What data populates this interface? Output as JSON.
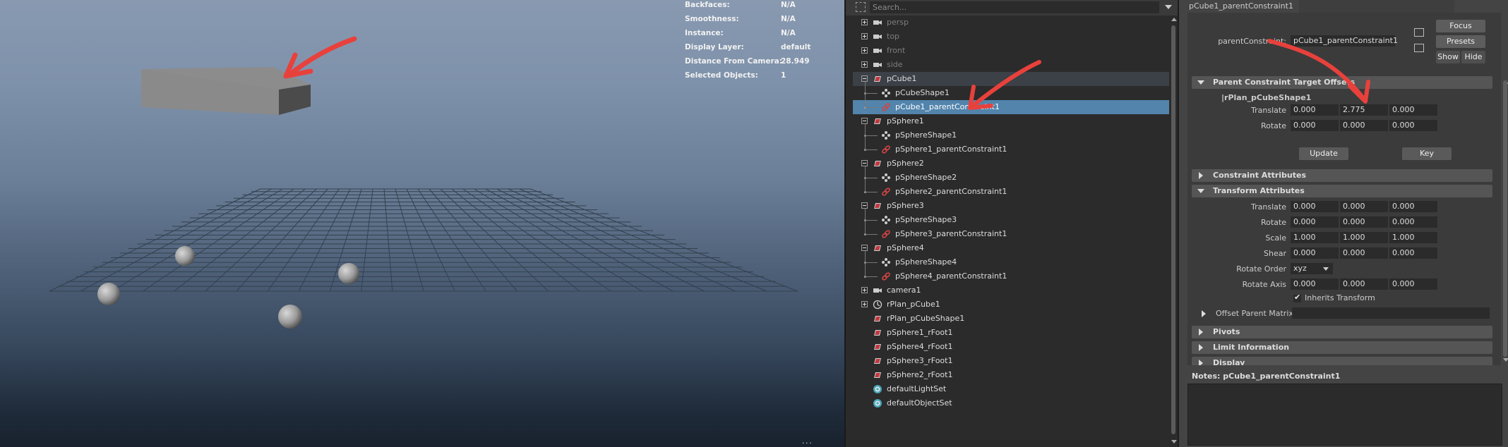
{
  "viewport": {
    "hud": [
      {
        "label": "Backfaces:",
        "value": "N/A"
      },
      {
        "label": "Smoothness:",
        "value": "N/A"
      },
      {
        "label": "Instance:",
        "value": "N/A"
      },
      {
        "label": "Display Layer:",
        "value": "default"
      },
      {
        "label": "Distance From Camera:",
        "value": "28.949"
      },
      {
        "label": "Selected Objects:",
        "value": "1"
      }
    ],
    "bottom_glyph": "···",
    "annotation_color": "#e8413c"
  },
  "outliner": {
    "search_placeholder": "Search...",
    "items": [
      {
        "label": "persp",
        "icon": "camera-icon",
        "expander": "plus",
        "dim": true
      },
      {
        "label": "top",
        "icon": "camera-icon",
        "expander": "plus",
        "dim": true
      },
      {
        "label": "front",
        "icon": "camera-icon",
        "expander": "plus",
        "dim": true
      },
      {
        "label": "side",
        "icon": "camera-icon",
        "expander": "plus",
        "dim": true
      },
      {
        "label": "pCube1",
        "icon": "mesh-transform-icon",
        "expander": "minus",
        "highlight": true
      },
      {
        "label": "pCubeShape1",
        "icon": "shape-icon",
        "child": true
      },
      {
        "label": "pCube1_parentConstraint1",
        "icon": "constraint-icon",
        "child": true,
        "selected": true
      },
      {
        "label": "pSphere1",
        "icon": "mesh-transform-icon",
        "expander": "minus"
      },
      {
        "label": "pSphereShape1",
        "icon": "shape-icon",
        "child": true
      },
      {
        "label": "pSphere1_parentConstraint1",
        "icon": "constraint-icon",
        "child": true
      },
      {
        "label": "pSphere2",
        "icon": "mesh-transform-icon",
        "expander": "minus"
      },
      {
        "label": "pSphereShape2",
        "icon": "shape-icon",
        "child": true
      },
      {
        "label": "pSphere2_parentConstraint1",
        "icon": "constraint-icon",
        "child": true
      },
      {
        "label": "pSphere3",
        "icon": "mesh-transform-icon",
        "expander": "minus"
      },
      {
        "label": "pSphereShape3",
        "icon": "shape-icon",
        "child": true
      },
      {
        "label": "pSphere3_parentConstraint1",
        "icon": "constraint-icon",
        "child": true
      },
      {
        "label": "pSphere4",
        "icon": "mesh-transform-icon",
        "expander": "minus"
      },
      {
        "label": "pSphereShape4",
        "icon": "shape-icon",
        "child": true
      },
      {
        "label": "pSphere4_parentConstraint1",
        "icon": "constraint-icon",
        "child": true
      },
      {
        "label": "camera1",
        "icon": "camera-icon",
        "expander": "plus"
      },
      {
        "label": "rPlan_pCube1",
        "icon": "locator-icon",
        "expander": "plus"
      },
      {
        "label": "rPlan_pCubeShape1",
        "icon": "mesh-transform-icon"
      },
      {
        "label": "pSphere1_rFoot1",
        "icon": "mesh-transform-icon"
      },
      {
        "label": "pSphere4_rFoot1",
        "icon": "mesh-transform-icon"
      },
      {
        "label": "pSphere3_rFoot1",
        "icon": "mesh-transform-icon"
      },
      {
        "label": "pSphere2_rFoot1",
        "icon": "mesh-transform-icon"
      },
      {
        "label": "defaultLightSet",
        "icon": "set-icon"
      },
      {
        "label": "defaultObjectSet",
        "icon": "set-icon"
      }
    ]
  },
  "attribute_editor": {
    "tab": "pCube1_parentConstraint1",
    "node_label": "parentConstraint:",
    "node_value": "pCube1_parentConstraint1",
    "buttons": {
      "focus": "Focus",
      "presets": "Presets",
      "show": "Show",
      "hide": "Hide",
      "update": "Update",
      "key": "Key"
    },
    "target_offsets": {
      "title": "Parent Constraint Target Offsets",
      "target": "|rPlan_pCubeShape1",
      "translate_label": "Translate",
      "translate": [
        "0.000",
        "2.775",
        "0.000"
      ],
      "rotate_label": "Rotate",
      "rotate": [
        "0.000",
        "0.000",
        "0.000"
      ]
    },
    "sections": {
      "constraint_attributes": "Constraint Attributes",
      "transform_attributes": "Transform Attributes",
      "pivots": "Pivots",
      "limit_information": "Limit Information",
      "display": "Display"
    },
    "transform": {
      "translate_label": "Translate",
      "translate": [
        "0.000",
        "0.000",
        "0.000"
      ],
      "rotate_label": "Rotate",
      "rotate": [
        "0.000",
        "0.000",
        "0.000"
      ],
      "scale_label": "Scale",
      "scale": [
        "1.000",
        "1.000",
        "1.000"
      ],
      "shear_label": "Shear",
      "shear": [
        "0.000",
        "0.000",
        "0.000"
      ],
      "rotate_order_label": "Rotate Order",
      "rotate_order": "xyz",
      "rotate_axis_label": "Rotate Axis",
      "rotate_axis": [
        "0.000",
        "0.000",
        "0.000"
      ],
      "inherits_label": "Inherits Transform",
      "offset_parent_label": "Offset Parent Matrix"
    },
    "notes_label": "Notes:  pCube1_parentConstraint1"
  }
}
